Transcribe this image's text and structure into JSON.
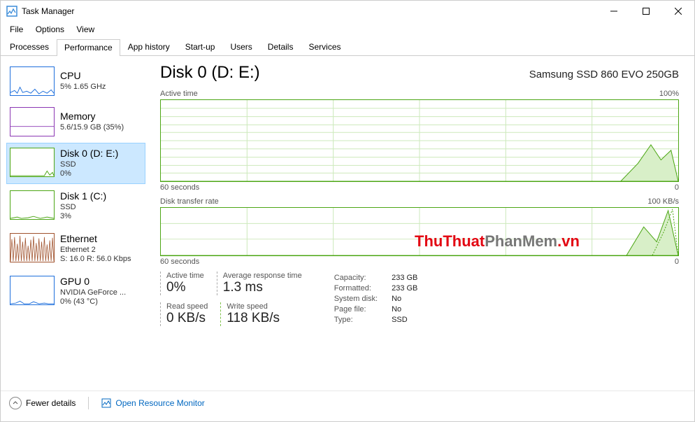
{
  "window": {
    "title": "Task Manager"
  },
  "menu": {
    "file": "File",
    "options": "Options",
    "view": "View"
  },
  "tabs": [
    "Processes",
    "Performance",
    "App history",
    "Start-up",
    "Users",
    "Details",
    "Services"
  ],
  "active_tab_index": 1,
  "sidebar": [
    {
      "title": "CPU",
      "sub1": "5%  1.65 GHz",
      "sub2": "",
      "color": "#1e6fdc"
    },
    {
      "title": "Memory",
      "sub1": "5.6/15.9 GB (35%)",
      "sub2": "",
      "color": "#8b36b3"
    },
    {
      "title": "Disk 0 (D: E:)",
      "sub1": "SSD",
      "sub2": "0%",
      "color": "#4ca614"
    },
    {
      "title": "Disk 1 (C:)",
      "sub1": "SSD",
      "sub2": "3%",
      "color": "#4ca614"
    },
    {
      "title": "Ethernet",
      "sub1": "Ethernet 2",
      "sub2": "S: 16.0  R: 56.0 Kbps",
      "color": "#a0522d"
    },
    {
      "title": "GPU 0",
      "sub1": "NVIDIA GeForce ...",
      "sub2": "0%  (43 °C)",
      "color": "#1e6fdc"
    }
  ],
  "selected_sidebar_index": 2,
  "detail": {
    "title": "Disk 0 (D: E:)",
    "model": "Samsung SSD 860 EVO 250GB",
    "chart1": {
      "label": "Active time",
      "max": "100%",
      "x0": "60 seconds",
      "x1": "0"
    },
    "chart2": {
      "label": "Disk transfer rate",
      "max": "100 KB/s",
      "x0": "60 seconds",
      "x1": "0"
    },
    "stats": {
      "active_time": {
        "label": "Active time",
        "value": "0%"
      },
      "avg_resp": {
        "label": "Average response time",
        "value": "1.3 ms"
      },
      "read_speed": {
        "label": "Read speed",
        "value": "0 KB/s"
      },
      "write_speed": {
        "label": "Write speed",
        "value": "118 KB/s"
      }
    },
    "info": {
      "capacity": {
        "label": "Capacity:",
        "value": "233 GB"
      },
      "formatted": {
        "label": "Formatted:",
        "value": "233 GB"
      },
      "system_disk": {
        "label": "System disk:",
        "value": "No"
      },
      "page_file": {
        "label": "Page file:",
        "value": "No"
      },
      "type": {
        "label": "Type:",
        "value": "SSD"
      }
    }
  },
  "footer": {
    "fewer": "Fewer details",
    "resmon": "Open Resource Monitor"
  },
  "watermark": {
    "a": "ThuThuat",
    "b": "PhanMem",
    "c": ".vn"
  },
  "chart_data": [
    {
      "type": "area",
      "title": "Active time",
      "ylabel": "%",
      "ylim": [
        0,
        100
      ],
      "xlabel": "seconds",
      "xlim": [
        60,
        0
      ],
      "series": [
        {
          "name": "Active time",
          "x": [
            60,
            58,
            56,
            54,
            52,
            50,
            48,
            46,
            44,
            42,
            40,
            38,
            36,
            34,
            32,
            30,
            28,
            26,
            24,
            22,
            20,
            18,
            16,
            14,
            12,
            10,
            8,
            6,
            4,
            2,
            0
          ],
          "values": [
            0,
            0,
            0,
            0,
            0,
            0,
            0,
            0,
            0,
            0,
            0,
            0,
            0,
            0,
            0,
            0,
            0,
            0,
            0,
            0,
            0,
            0,
            0,
            0,
            0,
            0,
            22,
            45,
            26,
            38,
            0
          ]
        }
      ]
    },
    {
      "type": "area",
      "title": "Disk transfer rate",
      "ylabel": "KB/s",
      "ylim": [
        0,
        100
      ],
      "xlabel": "seconds",
      "xlim": [
        60,
        0
      ],
      "series": [
        {
          "name": "Write",
          "style": "solid",
          "x": [
            60,
            10,
            8,
            6,
            4,
            2,
            0
          ],
          "values": [
            0,
            0,
            0,
            60,
            30,
            95,
            0
          ]
        },
        {
          "name": "Read",
          "style": "dotted",
          "x": [
            60,
            10,
            8,
            6,
            4,
            2,
            0
          ],
          "values": [
            0,
            0,
            0,
            0,
            50,
            100,
            0
          ]
        }
      ]
    }
  ]
}
